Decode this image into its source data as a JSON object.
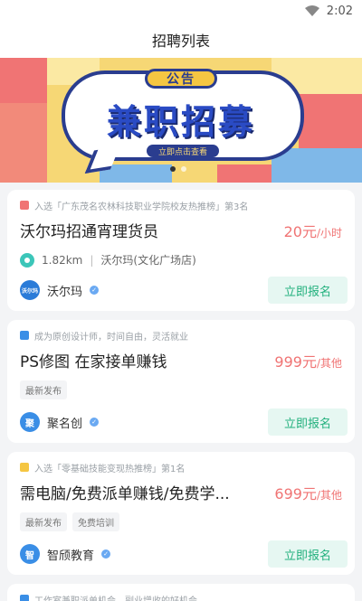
{
  "status_bar": {
    "time": "2:02",
    "wifi_icon": "wifi-icon"
  },
  "header": {
    "title": "招聘列表"
  },
  "banner": {
    "tag": "公告",
    "title": "兼职招募",
    "cta": "立即点击查看",
    "colors": {
      "blue": "#2a3d8f",
      "yellow": "#f6d775",
      "red": "#f07474"
    }
  },
  "jobs": [
    {
      "tagline": "入选「广东茂名农林科技职业学院校友热推榜」第3名",
      "title": "沃尔玛招通宵理货员",
      "salary": "20元",
      "salary_unit": "/小时",
      "distance": "1.82km",
      "location_name": "沃尔玛(文化广场店)",
      "company": "沃尔玛",
      "company_logo_text": "沃尔玛",
      "apply": "立即报名"
    },
    {
      "tagline": "成为原创设计师，时间自由，灵活就业",
      "title": "PS修图 在家接单赚钱",
      "salary": "999元",
      "salary_unit": "/其他",
      "chips": [
        "最新发布"
      ],
      "company": "聚名创",
      "company_logo_text": "聚",
      "apply": "立即报名"
    },
    {
      "tagline": "入选「零基础技能变现热推榜」第1名",
      "title": "需电脑/免费派单赚钱/免费学...",
      "salary": "699元",
      "salary_unit": "/其他",
      "chips": [
        "最新发布",
        "免费培训"
      ],
      "company": "智颀教育",
      "company_logo_text": "智",
      "apply": "立即报名"
    }
  ],
  "peek_card": {
    "tagline": "工作室兼职派单机会，副业增收的好机会"
  }
}
